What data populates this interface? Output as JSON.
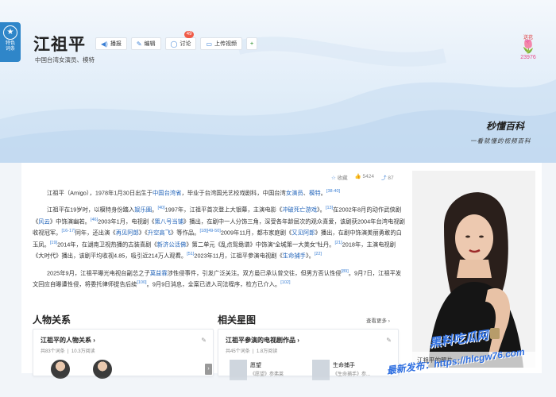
{
  "header": {
    "feature_badge": [
      "特色",
      "词条"
    ],
    "title": "江祖平",
    "subtitle": "中国台湾女演员、模特",
    "buttons": {
      "play": "播报",
      "edit": "编辑",
      "discuss": "讨论",
      "discuss_count": "49",
      "upload_video": "上传视频",
      "add": "+"
    },
    "rank": {
      "tag": "送花",
      "count": "23976"
    },
    "brand": "秒懂百科",
    "brand_slogan": "一看就懂的视频百科"
  },
  "meta": {
    "favorite": "收藏",
    "likes": "5424",
    "shares": "87"
  },
  "summary": {
    "p1": [
      {
        "t": "江祖平（Amigo），1978年1月30日出生于"
      },
      {
        "t": "中国台湾省",
        "link": true
      },
      {
        "t": "，毕业于台湾国光艺校戏剧科，中国台湾"
      },
      {
        "t": "女演员",
        "link": true
      },
      {
        "t": "、"
      },
      {
        "t": "模特",
        "link": true
      },
      {
        "t": "。"
      },
      {
        "t": "[38-40]",
        "sup": true
      }
    ],
    "p2": [
      {
        "t": "江祖平在19岁时，以模特身份踏入"
      },
      {
        "t": "娱乐圈",
        "link": true
      },
      {
        "t": "。"
      },
      {
        "t": "[40]",
        "sup": true
      },
      {
        "t": "1997年，江祖平首次登上大银幕，主演电影《"
      },
      {
        "t": "冲破死亡游戏",
        "link": true
      },
      {
        "t": "》。"
      },
      {
        "t": "[13]",
        "sup": true
      },
      {
        "t": "在2002年8月的动作武侠剧《"
      },
      {
        "t": "风云",
        "link": true
      },
      {
        "t": "》中饰演幽若。"
      },
      {
        "t": "[46]",
        "sup": true
      },
      {
        "t": "2003年1月，电视剧《"
      },
      {
        "t": "第八号当铺",
        "link": true
      },
      {
        "t": "》播出，在剧中一人分饰三角，深受各年龄层次的观众喜爱，该剧获2004年台湾电视剧收视冠军。"
      },
      {
        "t": "[16-17]",
        "sup": true
      },
      {
        "t": "同年，还出演《"
      },
      {
        "t": "再见阿郎",
        "link": true
      },
      {
        "t": "》《"
      },
      {
        "t": "升空高飞",
        "link": true
      },
      {
        "t": "》等作品。"
      },
      {
        "t": "[18]",
        "sup": true
      },
      {
        "t": "[49-50]",
        "sup": true
      },
      {
        "t": "2009年11月，都市家庭剧《"
      },
      {
        "t": "又见阿郎",
        "link": true
      },
      {
        "t": "》播出，在剧中饰演美丽勇敢的白玉凤。"
      },
      {
        "t": "[19]",
        "sup": true
      },
      {
        "t": "2014年，在湖南卫视热播的古装喜剧《"
      },
      {
        "t": "新济公活佛",
        "link": true
      },
      {
        "t": "》第二单元《乱点鸳鸯谱》中饰演“全城第一大美女”牡丹。"
      },
      {
        "t": "[21]",
        "sup": true
      },
      {
        "t": "2018年，主演电视剧《大时代》播出，该剧平均收视4.85，吸引近214万人观看。"
      },
      {
        "t": "[51]",
        "sup": true
      },
      {
        "t": "2023年11月，江祖平参演电视剧《"
      },
      {
        "t": "生命捕手",
        "link": true
      },
      {
        "t": "》。"
      },
      {
        "t": "[22]",
        "sup": true
      }
    ],
    "p3": [
      {
        "t": "2025年9月，江祖平曝光电视台副总之子"
      },
      {
        "t": "莫益霖",
        "link": true
      },
      {
        "t": "涉性侵事件，引发广泛关注。双方虽已承认曾交往，但男方否认性侵"
      },
      {
        "t": "[89]",
        "sup": true
      },
      {
        "t": "。9月7日，江祖平发文回应自曝遭性侵，将委托律师提告后续"
      },
      {
        "t": "[100]",
        "sup": true
      },
      {
        "t": "。9月9日消息，全案已进入司法程序，检方已介入。"
      },
      {
        "t": "[102]",
        "sup": true
      }
    ]
  },
  "photo_caption": "江祖平的照片",
  "relations": {
    "section_title": "人物关系",
    "card_title": "江祖平的人物关系",
    "stats": [
      "共83个词条",
      "10.3万阅读"
    ]
  },
  "star_map": {
    "section_title": "相关星图",
    "view_all": "查看更多",
    "card_title": "江祖平参演的电视剧作品",
    "stats": [
      "共45个词条",
      "1.8万阅读"
    ],
    "shows": [
      {
        "name": "愿望",
        "sub": "《愿望》参弗莱"
      },
      {
        "name": "生命捕手",
        "sub": "《生命捕手》参..."
      }
    ]
  },
  "watermark": [
    "黑料吃瓜网",
    "最新发布：https://hlcgw76.com"
  ]
}
